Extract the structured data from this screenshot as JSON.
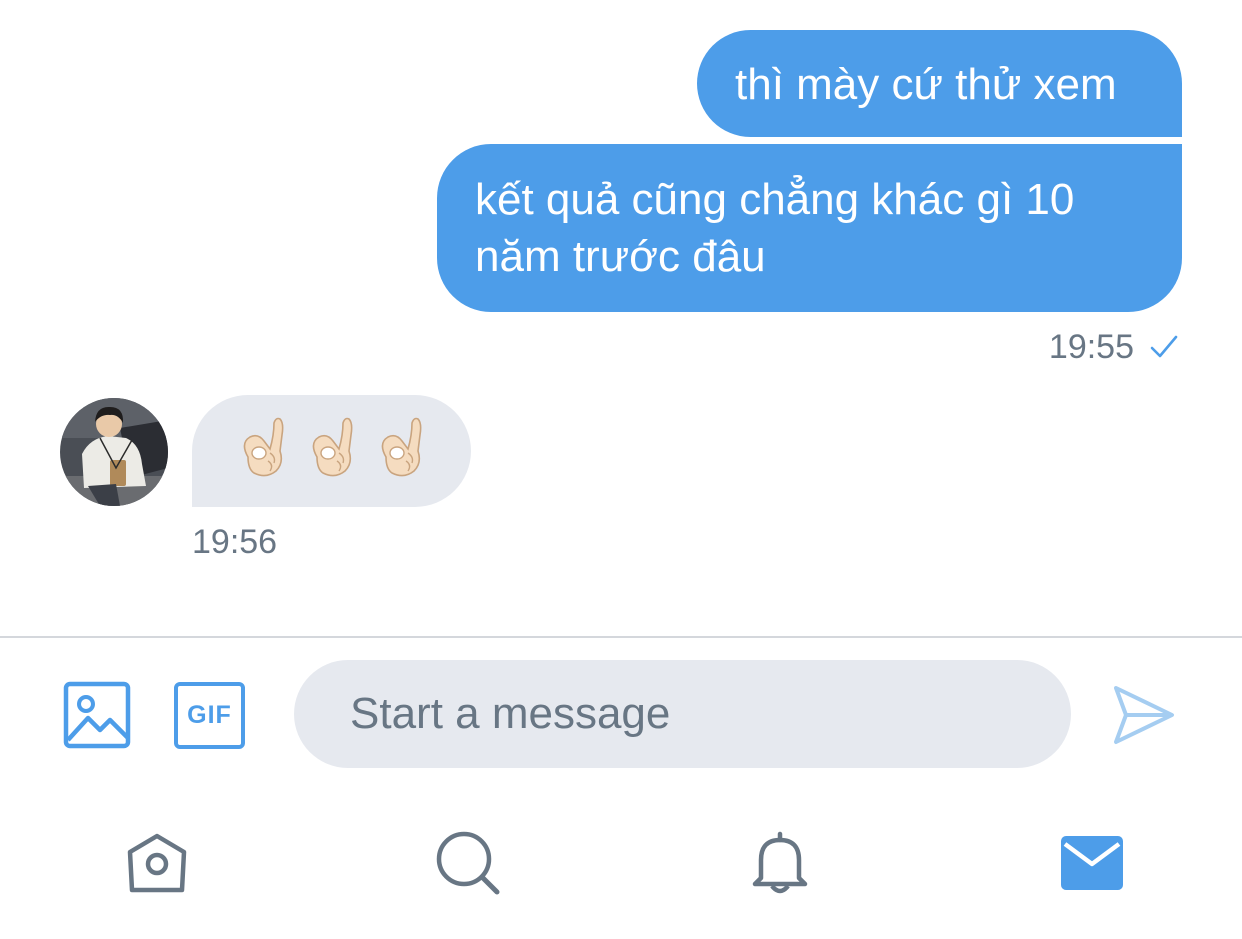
{
  "conversation": {
    "messages": [
      {
        "direction": "outgoing",
        "text": "thì mày cứ thử xem"
      },
      {
        "direction": "outgoing",
        "text": "kết quả cũng chẳng khác gì 10 năm trước đâu",
        "time": "19:55",
        "status_icon": "check-icon"
      },
      {
        "direction": "incoming",
        "text": "👌🏻👌🏻👌🏻",
        "time": "19:56",
        "avatar": "avatar-photo"
      }
    ]
  },
  "composer": {
    "placeholder": "Start a message",
    "gif_label": "GIF",
    "icons": [
      "image-icon",
      "gif-icon",
      "send-icon"
    ]
  },
  "bottom_nav": {
    "items": [
      "home-icon",
      "search-icon",
      "bell-icon",
      "mail-icon"
    ],
    "active": "mail-icon"
  },
  "colors": {
    "accent": "#4d9de9",
    "incoming_bubble": "#e6e9ef",
    "secondary_text": "#687684",
    "send_disabled": "#a5cdf1"
  }
}
